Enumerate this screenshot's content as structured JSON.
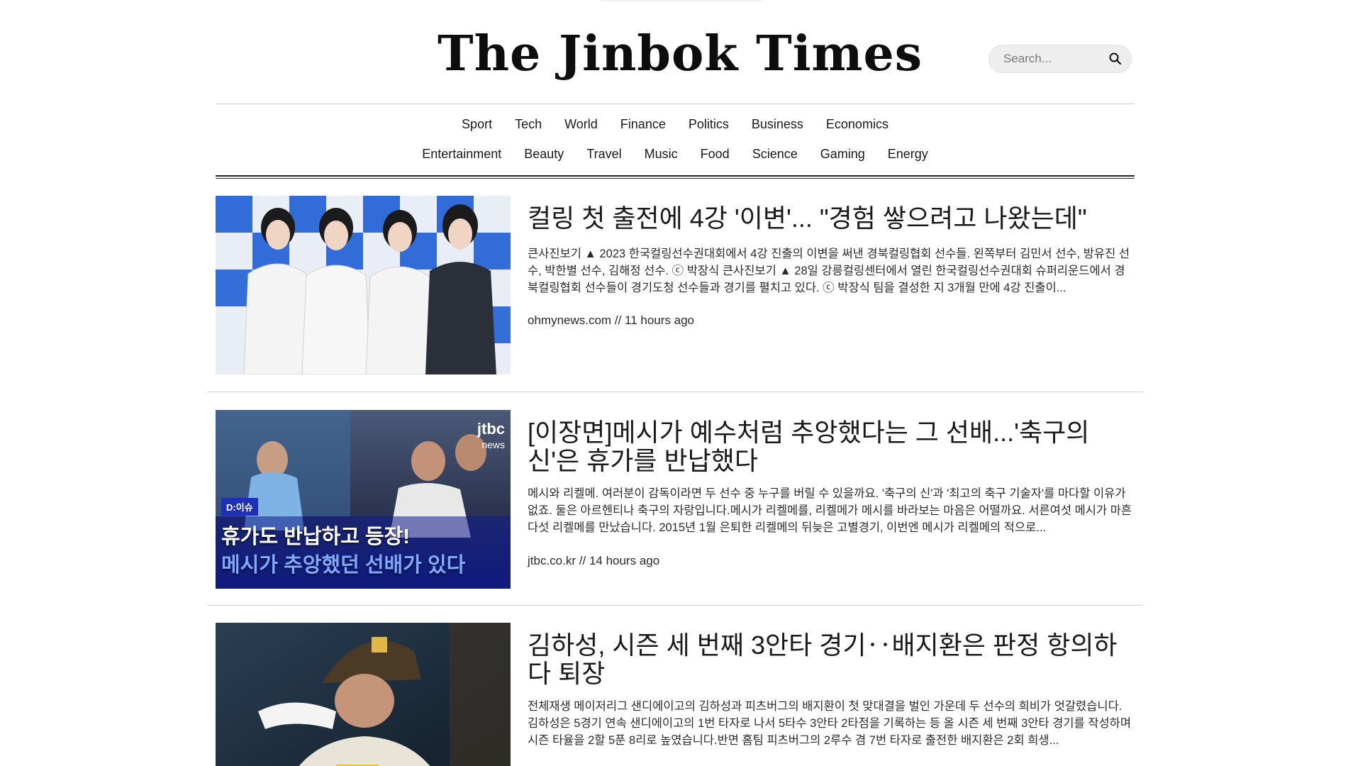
{
  "brand": {
    "name": "The Jinbok Times"
  },
  "search": {
    "placeholder": "Search...",
    "icon": "search-icon"
  },
  "nav": {
    "row1": [
      "Sport",
      "Tech",
      "World",
      "Finance",
      "Politics",
      "Business",
      "Economics"
    ],
    "row2": [
      "Entertainment",
      "Beauty",
      "Travel",
      "Music",
      "Food",
      "Science",
      "Gaming",
      "Energy"
    ]
  },
  "articles": [
    {
      "headline": "컬링 첫 출전에 4강 '이변'... \"경험 쌓으려고 나왔는데\"",
      "summary": "큰사진보기 ▲ 2023 한국컬링선수권대회에서 4강 진출의 이변을 써낸 경북컬링협회 선수들. 왼쪽부터 김민서 선수, 방유진 선수, 박한별 선수, 김해정 선수. ⓒ 박장식 큰사진보기 ▲ 28일 강릉컬링센터에서 열린 한국컬링선수권대회 슈퍼리운드에서 경북컬링협회 선수들이 경기도청 선수들과 경기를 펼치고 있다. ⓒ 박장식 팀을 결성한 지 3개월 만에 4강 진출이...",
      "source": "ohmynews.com",
      "time": "11 hours ago",
      "image": "curling-team-photo"
    },
    {
      "headline": "[이장면]메시가 예수처럼 추앙했다는 그 선배...'축구의 신'은 휴가를 반납했다",
      "summary": "메시와 리켈메. 여러분이 감독이라면 두 선수 중 누구를 버릴 수 있을까요. '축구의 신'과 '최고의 축구 기술자'를 마다할 이유가 없죠. 둘은 아르헨티나 축구의 자랑입니다.메시가 리켈메를, 리켈메가 메시를 바라보는 마음은 어떨까요. 서른여섯 메시가 마흔다섯 리켈메를 만났습니다. 2015년 1월 은퇴한 리켈메의 뒤늦은 고별경기, 이번엔 메시가 리켈메의 적으로...",
      "source": "jtbc.co.kr",
      "time": "14 hours ago",
      "image": "messi-riquelme-news-thumbnail",
      "thumb_badge": "D:이슈",
      "thumb_line1": "휴가도 반납하고 등장!",
      "thumb_line2": "메시가 추앙했던 선배가 있다",
      "thumb_logo": "jtbc",
      "thumb_logo_sub": "news"
    },
    {
      "headline": "김하성, 시즌 세 번째 3안타 경기‥배지환은 판정 항의하다 퇴장",
      "summary": "전체재생 메이저리그 샌디에이고의 김하성과 피츠버그의 배지환이 첫 맞대결을 벌인 가운데 두 선수의 희비가 엇갈렸습니다. 김하성은 5경기 연속 샌디에이고의 1번 타자로 나서 5타수 3안타 2타점을 기록하는 등 올 시즌 세 번째 3안타 경기를 작성하며 시즌 타율을 2할 5푼 8리로 높였습니다.반면 홈팀 피츠버그의 2루수 겸 7번 타자로 출전한 배지환은 2회 희생...",
      "source": "",
      "time": "",
      "image": "baseball-player-photo"
    }
  ]
}
